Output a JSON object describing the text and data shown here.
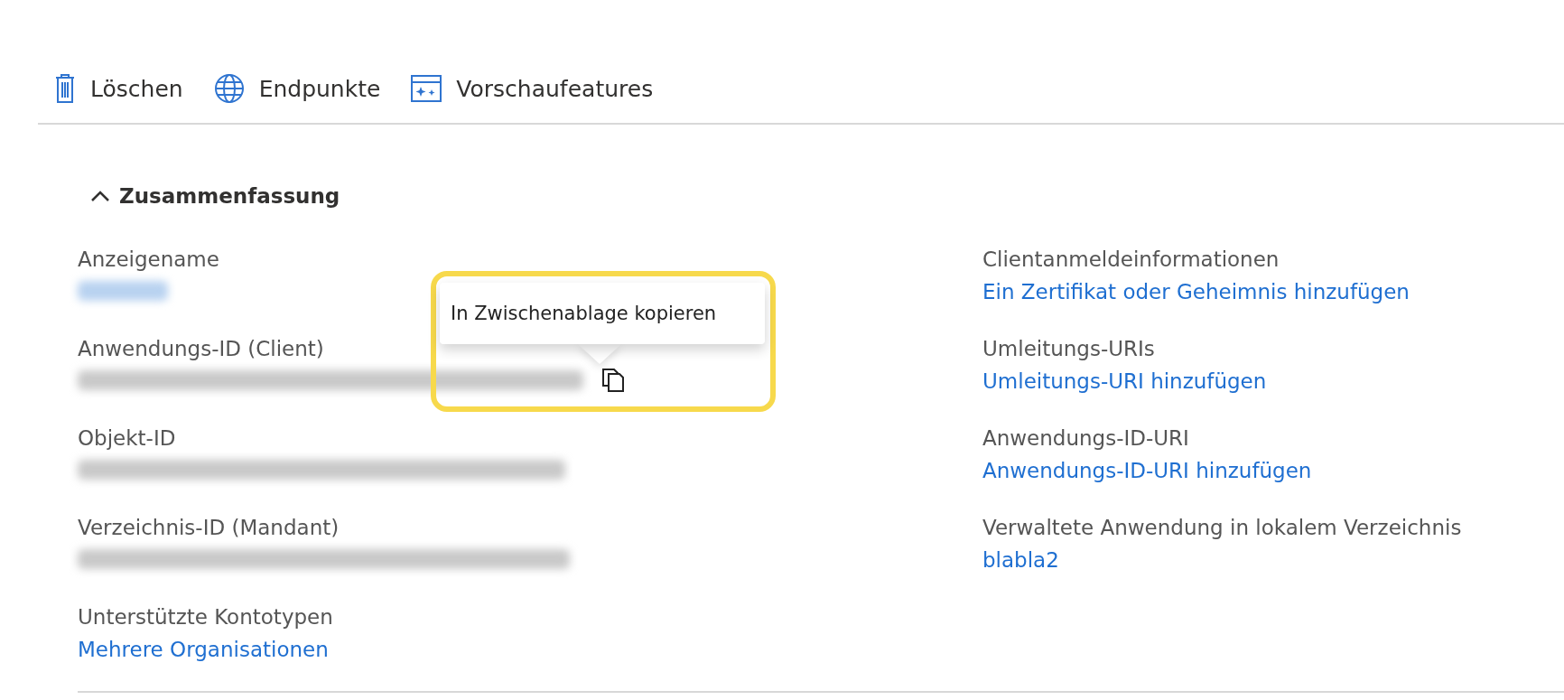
{
  "toolbar": [
    {
      "label": "Löschen",
      "kind": "trash"
    },
    {
      "label": "Endpunkte",
      "kind": "globe"
    },
    {
      "label": "Vorschaufeatures",
      "kind": "preview"
    }
  ],
  "summary": {
    "title": "Zusammenfassung",
    "expanded": true,
    "left": [
      {
        "label": "Anzeigename",
        "kind": "redacted_link"
      },
      {
        "label": "Anwendungs-ID (Client)",
        "kind": "redacted_copy"
      },
      {
        "label": "Objekt-ID",
        "kind": "redacted"
      },
      {
        "label": "Verzeichnis-ID (Mandant)",
        "kind": "redacted"
      },
      {
        "label": "Unterstützte Kontotypen",
        "kind": "link",
        "value": "Mehrere Organisationen"
      }
    ],
    "right": [
      {
        "label": "Clientanmeldeinformationen",
        "kind": "link",
        "value": "Ein Zertifikat oder Geheimnis hinzufügen"
      },
      {
        "label": "Umleitungs-URIs",
        "kind": "link",
        "value": "Umleitungs-URI hinzufügen"
      },
      {
        "label": "Anwendungs-ID-URI",
        "kind": "link",
        "value": "Anwendungs-ID-URI hinzufügen"
      },
      {
        "label": "Verwaltete Anwendung in lokalem Verzeichnis",
        "kind": "link",
        "value": "blabla2"
      }
    ]
  },
  "tooltip": {
    "text": "In Zwischenablage kopieren"
  }
}
